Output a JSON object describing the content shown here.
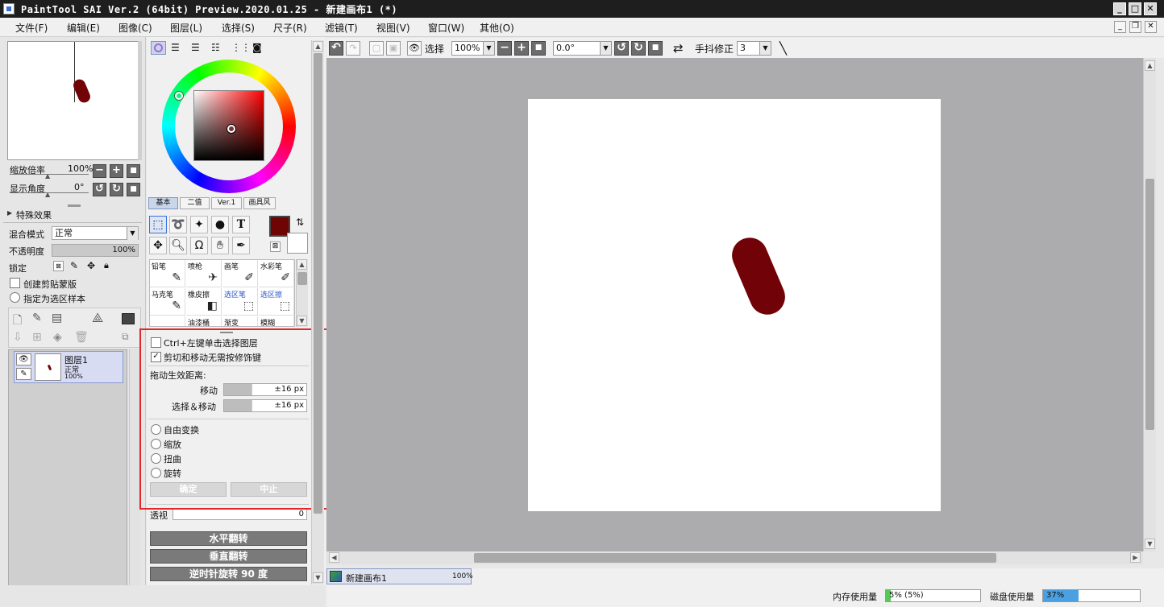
{
  "window": {
    "title": "PaintTool SAI Ver.2 (64bit) Preview.2020.01.25 - 新建画布1 (*)",
    "buttons": {
      "minimize": "_",
      "maximize": "□",
      "close": "✕"
    }
  },
  "menubar": {
    "items": [
      "文件(F)",
      "编辑(E)",
      "图像(C)",
      "图层(L)",
      "选择(S)",
      "尺子(R)",
      "滤镜(T)",
      "视图(V)",
      "窗口(W)",
      "其他(O)"
    ]
  },
  "navigator": {
    "zoom_label": "缩放倍率",
    "zoom_value": "100%",
    "angle_label": "显示角度",
    "angle_value": "0°"
  },
  "layer_panel": {
    "effects_label": "特殊效果",
    "blend_label": "混合模式",
    "blend_value": "正常",
    "opacity_label": "不透明度",
    "opacity_value": "100%",
    "lock_label": "锁定",
    "clip_label": "创建剪贴蒙版",
    "sample_label": "指定为选区样本",
    "layer": {
      "name": "图层1",
      "mode": "正常",
      "opacity": "100%"
    }
  },
  "color_tabs": [
    "基本",
    "二值",
    "Ver.1",
    "画具风"
  ],
  "colors": {
    "primary": "#6e0404",
    "secondary": "#ffffff",
    "stroke": "#710208"
  },
  "brushes": [
    [
      "铅笔",
      "喷枪",
      "画笔",
      "水彩笔"
    ],
    [
      "马克笔",
      "橡皮擦",
      "选区笔",
      "选区擦"
    ],
    [
      "",
      "油漆桶",
      "渐变",
      "模糊"
    ]
  ],
  "move_options": {
    "ctrl_click_label": "Ctrl+左键单击选择图层",
    "cut_move_label": "剪切和移动无需按修饰键",
    "drag_distance_label": "拖动生效距离:",
    "move_label": "移动",
    "move_value": "±16 px",
    "select_move_label": "选择＆移动",
    "select_move_value": "±16 px",
    "transforms": [
      "自由变换",
      "缩放",
      "扭曲",
      "旋转"
    ],
    "ok": "确定",
    "cancel": "中止",
    "perspective_label": "透视",
    "perspective_value": "0"
  },
  "actions": {
    "flip_h": "水平翻转",
    "flip_v": "垂直翻转",
    "rotate_ccw": "逆时针旋转 90 度"
  },
  "canvas_toolbar": {
    "select_label": "选择",
    "zoom_value": "100%",
    "angle_value": "0.0°",
    "stabilizer_label": "手抖修正",
    "stabilizer_value": "3"
  },
  "document_tab": {
    "name": "新建画布1",
    "zoom": "100%"
  },
  "status": {
    "memory_label": "内存使用量",
    "memory_value": "5% (5%)",
    "memory_fraction": 0.05,
    "disk_label": "磁盘使用量",
    "disk_value": "37%",
    "disk_fraction": 0.37
  }
}
